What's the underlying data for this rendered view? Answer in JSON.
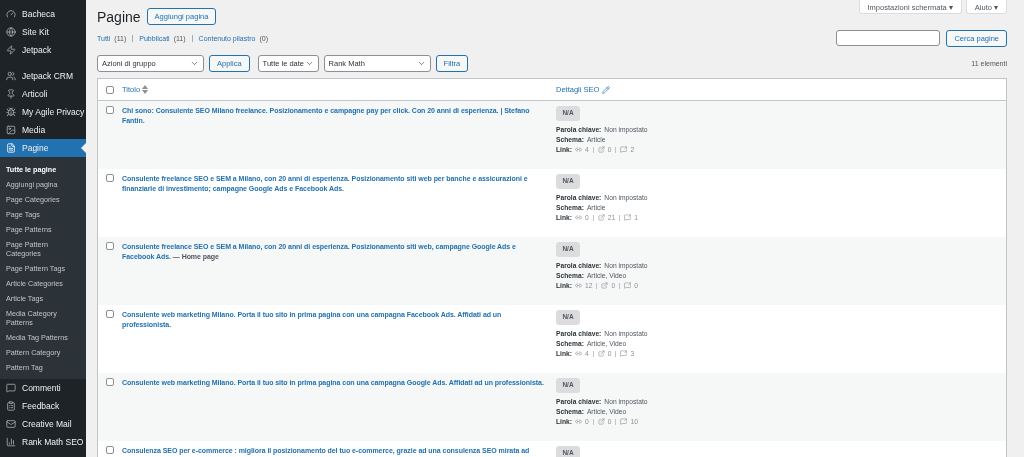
{
  "sidebar": {
    "items": [
      {
        "label": "Bacheca",
        "selected": false
      },
      {
        "label": "Site Kit",
        "selected": false
      },
      {
        "label": "Jetpack",
        "selected": false
      },
      {
        "label": "Jetpack CRM",
        "selected": false
      },
      {
        "label": "Articoli",
        "selected": false
      },
      {
        "label": "My Agile Privacy",
        "selected": false
      },
      {
        "label": "Media",
        "selected": false
      },
      {
        "label": "Pagine",
        "selected": true,
        "children": [
          {
            "label": "Tutte le pagine",
            "selected": true
          },
          {
            "label": "Aggiungi pagina",
            "selected": false
          },
          {
            "label": "Page Categories",
            "selected": false
          },
          {
            "label": "Page Tags",
            "selected": false
          },
          {
            "label": "Page Patterns",
            "selected": false
          },
          {
            "label": "Page Pattern Categories",
            "selected": false
          },
          {
            "label": "Page Pattern Tags",
            "selected": false
          },
          {
            "label": "Article Categories",
            "selected": false
          },
          {
            "label": "Article Tags",
            "selected": false
          },
          {
            "label": "Media Category Patterns",
            "selected": false
          },
          {
            "label": "Media Tag Patterns",
            "selected": false
          },
          {
            "label": "Pattern Category",
            "selected": false
          },
          {
            "label": "Pattern Tag",
            "selected": false
          }
        ]
      },
      {
        "label": "Commenti",
        "selected": false
      },
      {
        "label": "Feedback",
        "selected": false
      },
      {
        "label": "Creative Mail",
        "selected": false
      },
      {
        "label": "Rank Math SEO",
        "selected": false
      }
    ]
  },
  "top_buttons": [
    "Impostazioni schermata ▾",
    "Aiuto ▾"
  ],
  "page_title": "Pagine",
  "add_button": "Aggiungi pagina",
  "filters": [
    {
      "label": "Tutti",
      "count": "(11)"
    },
    {
      "label": "Pubblicati",
      "count": "(11)"
    },
    {
      "label": "Contenuto pilastro",
      "count": "(0)"
    }
  ],
  "search": {
    "button": "Cerca pagine"
  },
  "toolbar": {
    "bulk_select": "Azioni di gruppo",
    "apply": "Applica",
    "date_select": "Tutte le date",
    "seo_select": "Rank Math",
    "filter": "Filtra",
    "count": "11 elementi"
  },
  "table": {
    "select_all_checked": false,
    "columns": [
      "Titolo",
      "Dettagli SEO"
    ],
    "rows": [
      {
        "title": "Chi sono: Consulente SEO Milano freelance. Posizionamento e campagne pay per click. Con 20 anni di esperienza. | Stefano Fantin.",
        "checked": false,
        "score": "N/A",
        "keyword_label": "Parola chiave:",
        "keyword": "Non impostato",
        "schema_label": "Schema:",
        "schema": "Article",
        "links_label": "Link:",
        "internal": "4",
        "external": "0",
        "incoming": "2"
      },
      {
        "title": "Consulente freelance SEO e SEM a Milano, con 20 anni di esperienza. Posizionamento siti web per banche e assicurazioni e finanziarie di investimento; campagne Google Ads e Facebook Ads.",
        "checked": false,
        "score": "N/A",
        "keyword_label": "Parola chiave:",
        "keyword": "Non impostato",
        "schema_label": "Schema:",
        "schema": "Article",
        "links_label": "Link:",
        "internal": "0",
        "external": "21",
        "incoming": "1"
      },
      {
        "title": "Consulente freelance SEO e SEM a Milano, con 20 anni di esperienza. Posizionamento siti web, campagne Google Ads e Facebook Ads.",
        "state": "— Home page",
        "checked": false,
        "score": "N/A",
        "keyword_label": "Parola chiave:",
        "keyword": "Non impostato",
        "schema_label": "Schema:",
        "schema": "Article, Video",
        "links_label": "Link:",
        "internal": "12",
        "external": "0",
        "incoming": "0"
      },
      {
        "title": "Consulente web marketing Milano. Porta il tuo sito in prima pagina con una campagna Facebook Ads. Affidati ad un professionista.",
        "checked": false,
        "score": "N/A",
        "keyword_label": "Parola chiave:",
        "keyword": "Non impostato",
        "schema_label": "Schema:",
        "schema": "Article, Video",
        "links_label": "Link:",
        "internal": "4",
        "external": "0",
        "incoming": "3"
      },
      {
        "title": "Consulente web marketing Milano. Porta il tuo sito in prima pagina con una campagna Google Ads. Affidati ad un professionista.",
        "checked": false,
        "score": "N/A",
        "keyword_label": "Parola chiave:",
        "keyword": "Non impostato",
        "schema_label": "Schema:",
        "schema": "Article, Video",
        "links_label": "Link:",
        "internal": "0",
        "external": "0",
        "incoming": "10"
      },
      {
        "title": "Consulenza SEO per e-commerce : migliora il posizionamento del tuo e-commerce, grazie ad una consulenza SEO mirata ad",
        "checked": false,
        "score": "N/A"
      }
    ]
  }
}
